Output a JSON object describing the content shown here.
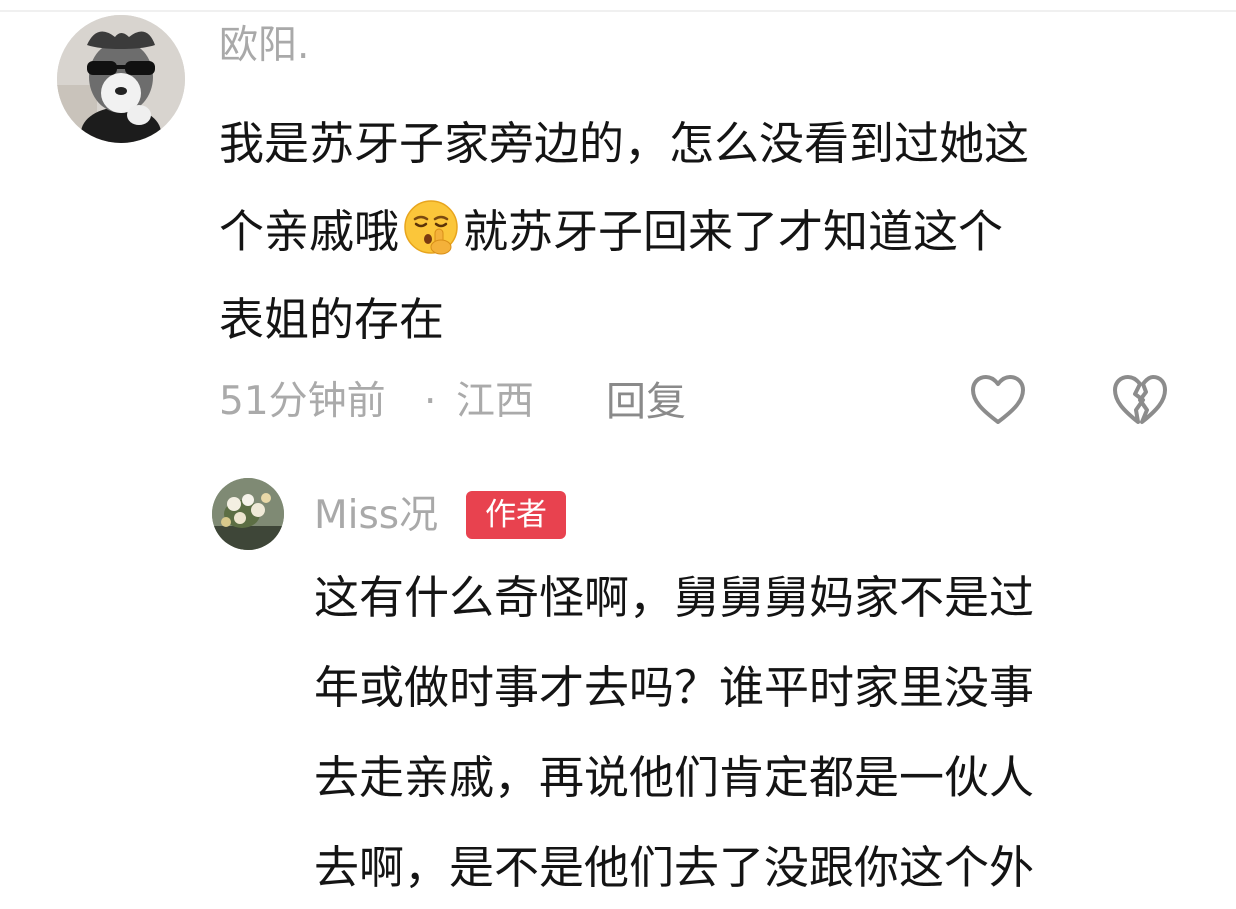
{
  "comment": {
    "username": "欧阳.",
    "text_lines": [
      "我是苏牙子家旁边的，怎么没看到过她这",
      "个亲戚哦",
      "就苏牙子回来了才知道这个",
      "表姐的存在"
    ],
    "emoji_icon": "shushing-face-emoji",
    "time": "51分钟前",
    "separator": "·",
    "location": "江西",
    "reply_label": "回复",
    "like_icon": "heart-outline-icon",
    "dislike_icon": "broken-heart-icon"
  },
  "reply": {
    "username": "Miss况",
    "author_tag": "作者",
    "text_lines": [
      "这有什么奇怪啊，舅舅舅妈家不是过",
      "年或做时事才去吗？谁平时家里没事",
      "去走亲戚，再说他们肯定都是一伙人",
      "去啊，是不是他们去了没跟你这个外"
    ]
  },
  "colors": {
    "author_tag_bg": "#e8424f",
    "username": "#a9a9a9",
    "text": "#141414",
    "meta": "#aaaaaa"
  }
}
